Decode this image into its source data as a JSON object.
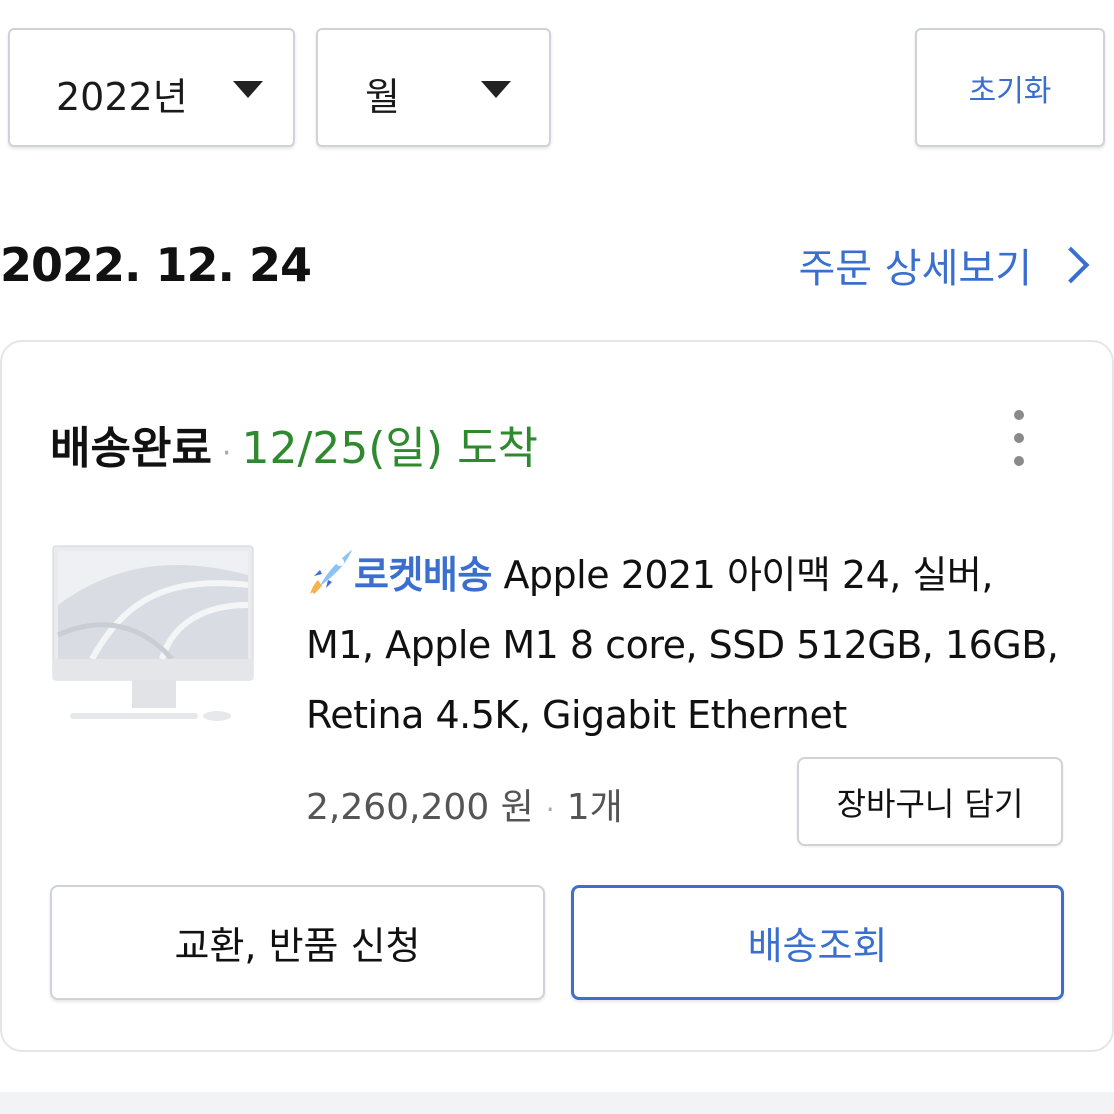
{
  "filters": {
    "year": "2022년",
    "month": "월",
    "reset_label": "초기화"
  },
  "order": {
    "date": "2022. 12. 24",
    "detail_link": "주문 상세보기"
  },
  "card": {
    "status": "배송완료",
    "separator": "·",
    "arrival": "12/25(일) 도착",
    "badge": "로켓배송",
    "product_title": "Apple 2021 아이맥 24, 실버, M1, Apple M1 8 core, SSD 512GB, 16GB, Retina 4.5K, Gigabit Ethernet",
    "price": "2,260,200 원",
    "quantity": "1개",
    "cart_button": "장바구니 담기",
    "exchange_button": "교환, 반품 신청",
    "track_button": "배송조회"
  },
  "icons": {
    "dropdown": "chevron-down-icon",
    "detail": "chevron-right-icon",
    "more": "more-vertical-icon",
    "rocket": "rocket-icon"
  },
  "colors": {
    "accent_blue": "#3a6fcf",
    "arrival_green": "#2f8a2f"
  }
}
